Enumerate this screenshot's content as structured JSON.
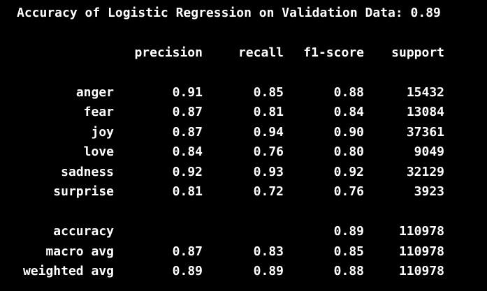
{
  "title": "Accuracy of Logistic Regression on Validation Data: 0.89",
  "headers": {
    "precision": "precision",
    "recall": "recall",
    "f1": "f1-score",
    "support": "support"
  },
  "classes": [
    {
      "label": "anger",
      "precision": "0.91",
      "recall": "0.85",
      "f1": "0.88",
      "support": "15432"
    },
    {
      "label": "fear",
      "precision": "0.87",
      "recall": "0.81",
      "f1": "0.84",
      "support": "13084"
    },
    {
      "label": "joy",
      "precision": "0.87",
      "recall": "0.94",
      "f1": "0.90",
      "support": "37361"
    },
    {
      "label": "love",
      "precision": "0.84",
      "recall": "0.76",
      "f1": "0.80",
      "support": "9049"
    },
    {
      "label": "sadness",
      "precision": "0.92",
      "recall": "0.93",
      "f1": "0.92",
      "support": "32129"
    },
    {
      "label": "surprise",
      "precision": "0.81",
      "recall": "0.72",
      "f1": "0.76",
      "support": "3923"
    }
  ],
  "summary": [
    {
      "label": "accuracy",
      "precision": "",
      "recall": "",
      "f1": "0.89",
      "support": "110978"
    },
    {
      "label": "macro avg",
      "precision": "0.87",
      "recall": "0.83",
      "f1": "0.85",
      "support": "110978"
    },
    {
      "label": "weighted avg",
      "precision": "0.89",
      "recall": "0.89",
      "f1": "0.88",
      "support": "110978"
    }
  ],
  "colors": {
    "background": "#000000",
    "text": "#ffffff"
  }
}
